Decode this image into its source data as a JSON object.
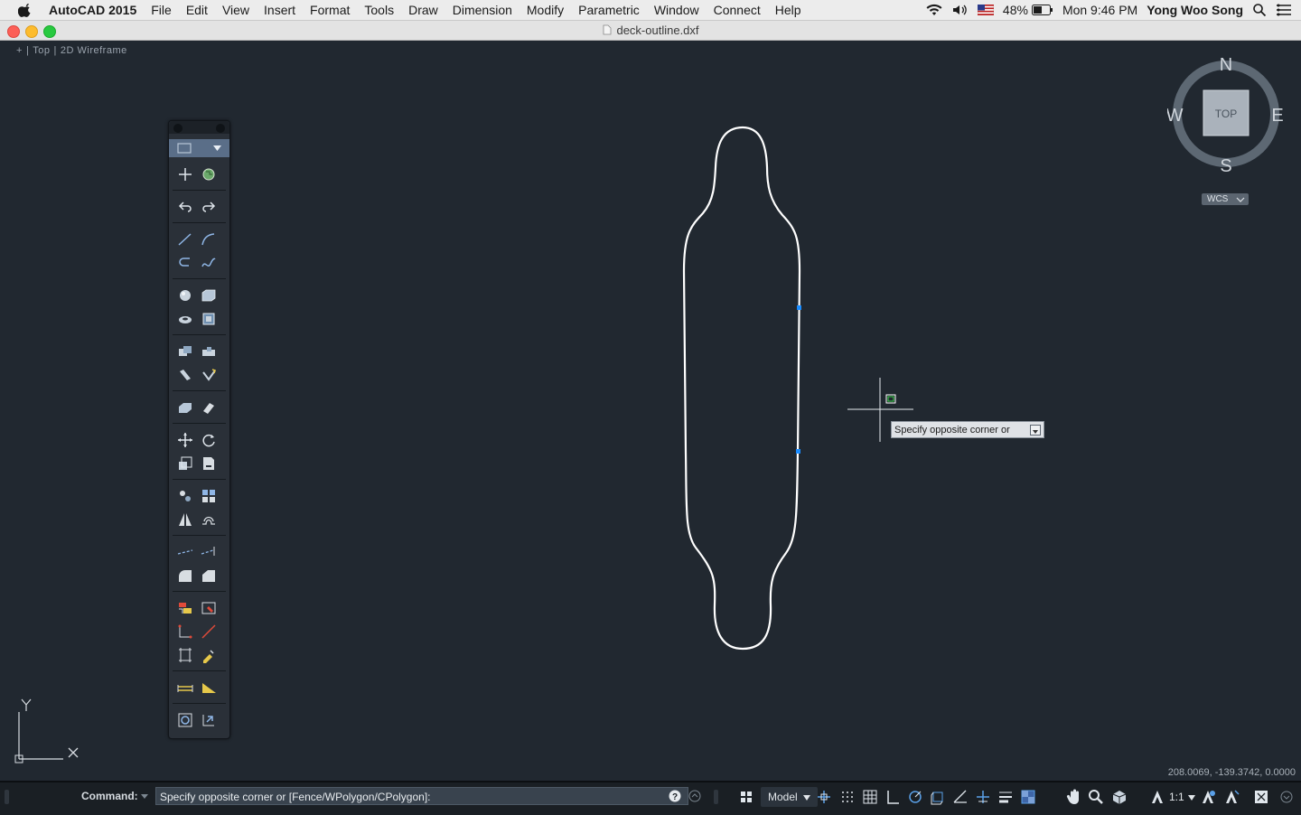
{
  "menubar": {
    "app_name": "AutoCAD 2015",
    "items": [
      "File",
      "Edit",
      "View",
      "Insert",
      "Format",
      "Tools",
      "Draw",
      "Dimension",
      "Modify",
      "Parametric",
      "Window",
      "Connect",
      "Help"
    ],
    "battery": "48%",
    "clock": "Mon 9:46 PM",
    "user": "Yong Woo Song"
  },
  "window": {
    "title": "deck-outline.dxf"
  },
  "viewport": {
    "minus": "+",
    "view": "Top",
    "style": "2D Wireframe"
  },
  "viewcube": {
    "north": "N",
    "south": "S",
    "east": "E",
    "west": "W",
    "face": "TOP",
    "wcs": "WCS"
  },
  "ucs": {
    "y_label": "Y",
    "x_label": "X"
  },
  "tooltip": {
    "text": "Specify opposite corner or"
  },
  "command": {
    "label": "Command:",
    "prompt": "Specify opposite corner or [Fence/WPolygon/CPolygon]:"
  },
  "coordinates": "208.0069, -139.3742, 0.0000",
  "statusbar": {
    "model": "Model",
    "scale": "1:1"
  },
  "colors": {
    "background": "#212830",
    "accent": "#1a8cff",
    "outline": "#ffffff"
  }
}
